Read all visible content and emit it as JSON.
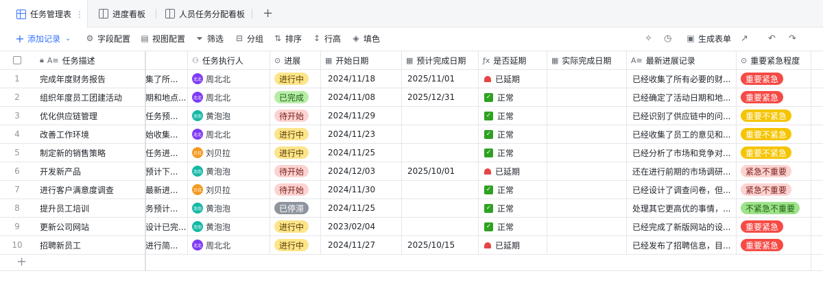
{
  "tabs": [
    {
      "label": "任务管理表",
      "icon": "grid-icon",
      "active": true
    },
    {
      "label": "进度看板",
      "icon": "kanban-icon"
    },
    {
      "label": "人员任务分配看板",
      "icon": "kanban-icon"
    }
  ],
  "tab_more_glyph": "⋮",
  "tab_add_glyph": "+",
  "toolbar": {
    "add_record": "添加记录",
    "field_config": "字段配置",
    "view_config": "视图配置",
    "filter": "筛选",
    "group": "分组",
    "sort": "排序",
    "row_height": "行高",
    "fill": "填色",
    "generate_form": "生成表单"
  },
  "columns": [
    {
      "key": "task",
      "label": "任务描述",
      "icon": "text-icon"
    },
    {
      "key": "desc",
      "label": "",
      "icon": ""
    },
    {
      "key": "owner",
      "label": "任务执行人",
      "icon": "person-icon"
    },
    {
      "key": "status",
      "label": "进展",
      "icon": "status-icon"
    },
    {
      "key": "start",
      "label": "开始日期",
      "icon": "date-icon"
    },
    {
      "key": "plan_end",
      "label": "预计完成日期",
      "icon": "date-icon"
    },
    {
      "key": "delayed",
      "label": "是否延期",
      "icon": "formula-icon"
    },
    {
      "key": "actual_end",
      "label": "实际完成日期",
      "icon": "date-icon"
    },
    {
      "key": "latest",
      "label": "最新进展记录",
      "icon": "text-icon"
    },
    {
      "key": "priority",
      "label": "重要紧急程度",
      "icon": "status-icon"
    }
  ],
  "people": {
    "周北北": {
      "avatar_text": "北北",
      "color": "#7f3bf5"
    },
    "黄泡泡": {
      "avatar_text": "泡泡",
      "color": "#14b8a6"
    },
    "刘贝拉": {
      "avatar_text": "贝拉",
      "color": "#f59a23"
    }
  },
  "status_colors": {
    "进行中": {
      "bg": "#fce58a",
      "fg": "#5c3c00"
    },
    "已完成": {
      "bg": "#b7eda7",
      "fg": "#1b5e10"
    },
    "待开始": {
      "bg": "#fcd3d1",
      "fg": "#7a1f1a"
    },
    "已停滞": {
      "bg": "#8f959e",
      "fg": "#ffffff"
    }
  },
  "priority_colors": {
    "重要紧急": {
      "bg": "#f54a45",
      "fg": "#ffffff"
    },
    "重要不紧急": {
      "bg": "#f5c400",
      "fg": "#ffffff"
    },
    "紧急不重要": {
      "bg": "#fcd3d1",
      "fg": "#7a1f1a"
    },
    "不紧急不重要": {
      "bg": "#9ee28a",
      "fg": "#1b5e10"
    }
  },
  "rows": [
    {
      "num": "1",
      "task": "完成年度财务报告",
      "desc": "集了所...",
      "owner": "周北北",
      "status": "进行中",
      "start": "2024/11/18",
      "plan_end": "2025/11/01",
      "delayed": "已延期",
      "actual_end": "",
      "latest": "已经收集了所有必要的财...",
      "priority": "重要紧急"
    },
    {
      "num": "2",
      "task": "组织年度员工团建活动",
      "desc": "期和地点...",
      "owner": "周北北",
      "status": "已完成",
      "start": "2024/11/08",
      "plan_end": "2025/12/31",
      "delayed": "正常",
      "actual_end": "",
      "latest": "已经确定了活动日期和地...",
      "priority": "重要紧急"
    },
    {
      "num": "3",
      "task": "优化供应链管理",
      "desc": "任务预...",
      "owner": "黄泡泡",
      "status": "待开始",
      "start": "2024/11/29",
      "plan_end": "",
      "delayed": "正常",
      "actual_end": "",
      "latest": "已经识别了供应链中的问...",
      "priority": "重要不紧急"
    },
    {
      "num": "4",
      "task": "改善工作环境",
      "desc": "始收集...",
      "owner": "周北北",
      "status": "进行中",
      "start": "2024/11/23",
      "plan_end": "",
      "delayed": "正常",
      "actual_end": "",
      "latest": "已经收集了员工的意见和...",
      "priority": "重要不紧急"
    },
    {
      "num": "5",
      "task": "制定新的销售策略",
      "desc": "任务进...",
      "owner": "刘贝拉",
      "status": "进行中",
      "start": "2024/11/25",
      "plan_end": "",
      "delayed": "正常",
      "actual_end": "",
      "latest": "已经分析了市场和竞争对...",
      "priority": "重要不紧急"
    },
    {
      "num": "6",
      "task": "开发新产品",
      "desc": "预计下...",
      "owner": "黄泡泡",
      "status": "待开始",
      "start": "2024/12/03",
      "plan_end": "2025/10/01",
      "delayed": "已延期",
      "actual_end": "",
      "latest": "还在进行前期的市场调研...",
      "priority": "紧急不重要"
    },
    {
      "num": "7",
      "task": "进行客户满意度调查",
      "desc": "最新进...",
      "owner": "刘贝拉",
      "status": "待开始",
      "start": "2024/11/30",
      "plan_end": "",
      "delayed": "正常",
      "actual_end": "",
      "latest": "已经设计了调查问卷，但...",
      "priority": "紧急不重要"
    },
    {
      "num": "8",
      "task": "提升员工培训",
      "desc": "务预计...",
      "owner": "黄泡泡",
      "status": "已停滞",
      "start": "2024/11/25",
      "plan_end": "",
      "delayed": "正常",
      "actual_end": "",
      "latest": "处理其它更高优的事情，...",
      "priority": "不紧急不重要"
    },
    {
      "num": "9",
      "task": "更新公司网站",
      "desc": "设计已完...",
      "owner": "黄泡泡",
      "status": "进行中",
      "start": "2023/02/04",
      "plan_end": "",
      "delayed": "正常",
      "actual_end": "",
      "latest": "已经完成了新版网站的设...",
      "priority": "重要紧急"
    },
    {
      "num": "10",
      "task": "招聘新员工",
      "desc": "进行简...",
      "owner": "周北北",
      "status": "进行中",
      "start": "2024/11/27",
      "plan_end": "2025/10/15",
      "delayed": "已延期",
      "actual_end": "",
      "latest": "已经发布了招聘信息，目...",
      "priority": "重要紧急"
    }
  ],
  "add_row_glyph": "+"
}
